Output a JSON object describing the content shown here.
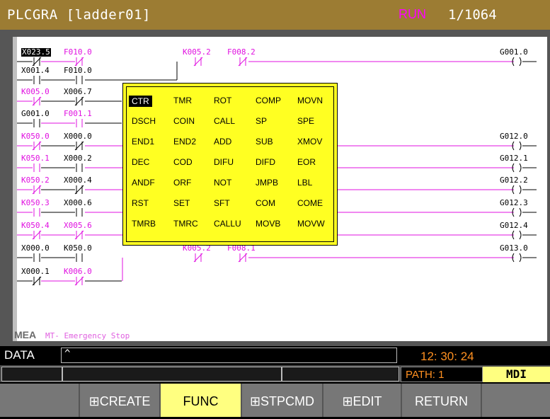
{
  "header": {
    "title": "PLCGRA [ladder01]",
    "status": "RUN",
    "page": "1/1064"
  },
  "ladder": {
    "rows": [
      {
        "labels": [
          {
            "text": "X023.5",
            "color": "k",
            "sel": true
          },
          {
            "text": "F010.0",
            "color": "m"
          },
          {
            "text": "K005.2",
            "color": "m"
          },
          {
            "text": "F008.2",
            "color": "m"
          }
        ],
        "coil": "G001.0"
      },
      {
        "labels": [
          {
            "text": "X001.4",
            "color": "k"
          },
          {
            "text": "F010.0",
            "color": "k"
          }
        ],
        "coil": ""
      },
      {
        "labels": [
          {
            "text": "K005.0",
            "color": "m"
          },
          {
            "text": "X006.7",
            "color": "k"
          }
        ],
        "coil": ""
      },
      {
        "labels": [
          {
            "text": "G001.0",
            "color": "k"
          },
          {
            "text": "F001.1",
            "color": "m"
          }
        ],
        "coil": ""
      },
      {
        "labels": [
          {
            "text": "K050.0",
            "color": "m"
          },
          {
            "text": "X000.0",
            "color": "k"
          }
        ],
        "coil": "G012.0"
      },
      {
        "labels": [
          {
            "text": "K050.1",
            "color": "m"
          },
          {
            "text": "X000.2",
            "color": "k"
          }
        ],
        "coil": "G012.1"
      },
      {
        "labels": [
          {
            "text": "K050.2",
            "color": "m"
          },
          {
            "text": "X000.4",
            "color": "k"
          }
        ],
        "coil": "G012.2"
      },
      {
        "labels": [
          {
            "text": "K050.3",
            "color": "m"
          },
          {
            "text": "X000.6",
            "color": "k"
          }
        ],
        "coil": "G012.3"
      },
      {
        "labels": [
          {
            "text": "K050.4",
            "color": "m"
          },
          {
            "text": "X005.6",
            "color": "m"
          }
        ],
        "coil": "G012.4"
      },
      {
        "labels": [
          {
            "text": "X000.0",
            "color": "k"
          },
          {
            "text": "K050.0",
            "color": "k"
          },
          {
            "text": "K005.2",
            "color": "m"
          },
          {
            "text": "F008.1",
            "color": "m"
          }
        ],
        "coil": "G013.0"
      },
      {
        "labels": [
          {
            "text": "X000.1",
            "color": "k"
          },
          {
            "text": "K006.0",
            "color": "m"
          }
        ],
        "coil": ""
      }
    ],
    "message_code": "MEA",
    "message_text": "MT- Emergency Stop"
  },
  "function_menu": {
    "selected": "CTR",
    "rows": [
      [
        "CTR",
        "TMR",
        "ROT",
        "COMP",
        "MOVN"
      ],
      [
        "DSCH",
        "COIN",
        "CALL",
        "SP",
        "SPE"
      ],
      [
        "END1",
        "END2",
        "ADD",
        "SUB",
        "XMOV"
      ],
      [
        "DEC",
        "COD",
        "DIFU",
        "DIFD",
        "EOR"
      ],
      [
        "ANDF",
        "ORF",
        "NOT",
        "JMPB",
        "LBL"
      ],
      [
        "RST",
        "SET",
        "SFT",
        "COM",
        "COME"
      ],
      [
        "TMRB",
        "TMRC",
        "CALLU",
        "MOVB",
        "MOVW"
      ]
    ]
  },
  "data": {
    "label": "DATA",
    "value": "^",
    "time": "12: 30: 24",
    "path": "PATH:  1",
    "mode": "MDI"
  },
  "softkeys": [
    "",
    "⊞CREATE",
    "FUNC",
    "⊞STPCMD",
    "⊞EDIT",
    "RETURN",
    ""
  ],
  "colors": {
    "title_bg": "#9c7c33",
    "popup_bg": "#ffff22",
    "accent_magenta": "#e010e0",
    "active_key": "#ffff80"
  }
}
